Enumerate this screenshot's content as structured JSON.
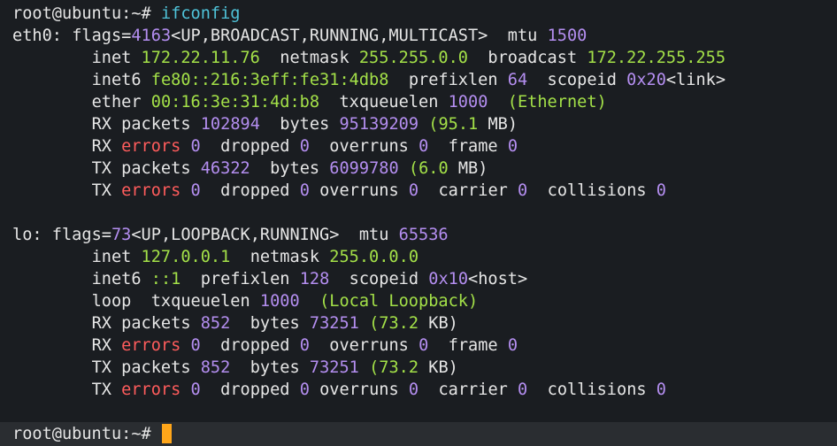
{
  "colors": {
    "background": "#1a1d21",
    "text": "#e6e6e6",
    "number": "#b48ef0",
    "value": "#a3e048",
    "error": "#ff5c5c",
    "command": "#4fc3d9",
    "cursor": "#ffa61a",
    "prompt_bar": "#2a2d31"
  },
  "prompt": "root@ubuntu:~#",
  "command": "ifconfig",
  "eth0": {
    "name": "eth0:",
    "flags_num": "4163",
    "flags": "<UP,BROADCAST,RUNNING,MULTICAST>",
    "mtu": "1500",
    "inet": "172.22.11.76",
    "netmask": "255.255.0.0",
    "broadcast": "172.22.255.255",
    "inet6": "fe80::216:3eff:fe31:4db8",
    "prefixlen": "64",
    "scopeid": "0x20",
    "scope_name": "<link>",
    "ether": "00:16:3e:31:4d:b8",
    "txqueuelen": "1000",
    "link_type": "(Ethernet)",
    "rx_packets": "102894",
    "rx_bytes": "95139209",
    "rx_bytes_h": "(95.1",
    "rx_unit": "MB)",
    "rx_errors": "0",
    "rx_dropped": "0",
    "rx_overruns": "0",
    "rx_frame": "0",
    "tx_packets": "46322",
    "tx_bytes": "6099780",
    "tx_bytes_h": "(6.0",
    "tx_unit": "MB)",
    "tx_errors": "0",
    "tx_dropped": "0",
    "tx_overruns": "0",
    "tx_carrier": "0",
    "tx_collisions": "0"
  },
  "lo": {
    "name": "lo:",
    "flags_num": "73",
    "flags": "<UP,LOOPBACK,RUNNING>",
    "mtu": "65536",
    "inet": "127.0.0.1",
    "netmask": "255.0.0.0",
    "inet6": "::1",
    "prefixlen": "128",
    "scopeid": "0x10",
    "scope_name": "<host>",
    "txqueuelen": "1000",
    "link_type": "(Local Loopback)",
    "rx_packets": "852",
    "rx_bytes": "73251",
    "rx_bytes_h": "(73.2",
    "rx_unit": "KB)",
    "rx_errors": "0",
    "rx_dropped": "0",
    "rx_overruns": "0",
    "rx_frame": "0",
    "tx_packets": "852",
    "tx_bytes": "73251",
    "tx_bytes_h": "(73.2",
    "tx_unit": "KB)",
    "tx_errors": "0",
    "tx_dropped": "0",
    "tx_overruns": "0",
    "tx_carrier": "0",
    "tx_collisions": "0"
  },
  "labels": {
    "flags": "flags=",
    "mtu": "mtu",
    "inet": "inet",
    "netmask": "netmask",
    "broadcast": "broadcast",
    "inet6": "inet6",
    "prefixlen": "prefixlen",
    "scopeid": "scopeid",
    "ether": "ether",
    "loop": "loop",
    "txqueuelen": "txqueuelen",
    "rx": "RX",
    "tx": "TX",
    "packets": "packets",
    "bytes": "bytes",
    "errors": "errors",
    "dropped": "dropped",
    "overruns": "overruns",
    "frame": "frame",
    "carrier": "carrier",
    "collisions": "collisions"
  }
}
